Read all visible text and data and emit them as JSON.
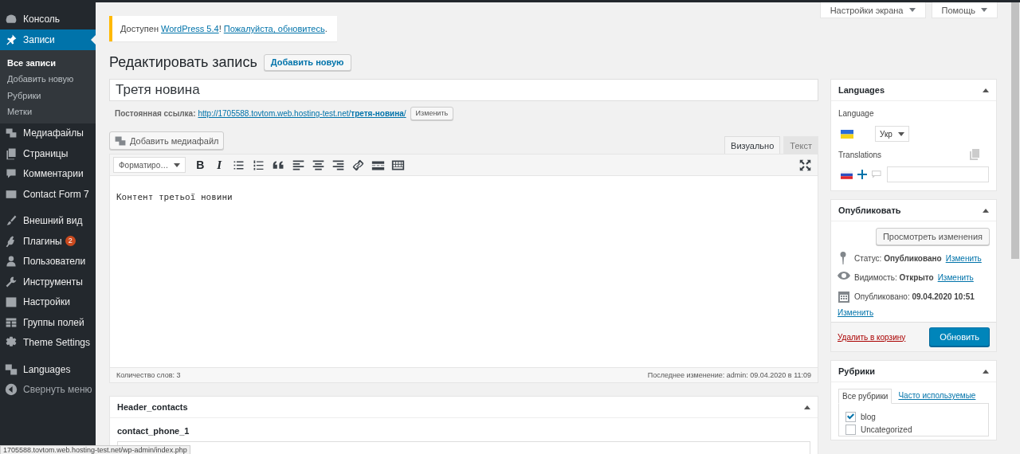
{
  "sidebar": {
    "groups": [
      {
        "items": [
          {
            "label": "Консоль",
            "selected": false
          },
          {
            "label": "Записи",
            "selected": true,
            "children": [
              {
                "label": "Все записи",
                "selected": true
              },
              {
                "label": "Добавить новую",
                "selected": false
              },
              {
                "label": "Рубрики",
                "selected": false
              },
              {
                "label": "Метки",
                "selected": false
              }
            ]
          },
          {
            "label": "Медиафайлы",
            "selected": false
          },
          {
            "label": "Страницы",
            "selected": false
          },
          {
            "label": "Комментарии",
            "selected": false
          },
          {
            "label": "Contact Form 7",
            "selected": false
          }
        ]
      },
      {
        "items": [
          {
            "label": "Внешний вид",
            "selected": false
          },
          {
            "label": "Плагины",
            "selected": false,
            "badge": "2"
          },
          {
            "label": "Пользователи",
            "selected": false
          },
          {
            "label": "Инструменты",
            "selected": false
          },
          {
            "label": "Настройки",
            "selected": false
          },
          {
            "label": "Группы полей",
            "selected": false
          },
          {
            "label": "Theme Settings",
            "selected": false
          }
        ]
      },
      {
        "items": [
          {
            "label": "Languages",
            "selected": false
          }
        ]
      }
    ],
    "collapse": "Свернуть меню"
  },
  "screen_tabs": [
    {
      "label": "Настройки экрана"
    },
    {
      "label": "Помощь"
    }
  ],
  "notice": [
    {
      "kind": "text",
      "text": "Доступен "
    },
    {
      "kind": "link",
      "text": "WordPress 5.4"
    },
    {
      "kind": "text",
      "text": "! "
    },
    {
      "kind": "link",
      "text": "Пожалуйста, обновитесь"
    },
    {
      "kind": "text",
      "text": "."
    }
  ],
  "page_title": "Редактировать запись",
  "add_new_button": "Добавить новую",
  "post_title": "Третя новина",
  "permalink": {
    "label": "Постоянная ссылка:",
    "url": "http://1705588.tovtom.web.hosting-test.net/**третя-новина**/",
    "button": "Изменить"
  },
  "add_media_button": "Добавить медиафайл",
  "editor_tabs": [
    {
      "label": "Визуально",
      "selected": true
    },
    {
      "label": "Текст",
      "selected": false
    }
  ],
  "toolbar": {
    "format": "Форматиро…",
    "buttons": [
      {
        "kind": "bold",
        "label": "B"
      },
      {
        "kind": "italic",
        "label": "I"
      },
      {
        "kind": "bullets"
      },
      {
        "kind": "numbers"
      },
      {
        "kind": "quote"
      },
      {
        "kind": "align-left"
      },
      {
        "kind": "align-center"
      },
      {
        "kind": "align-right"
      },
      {
        "kind": "link"
      },
      {
        "kind": "more"
      },
      {
        "kind": "toggle"
      }
    ]
  },
  "content": "Контент третьої новини",
  "word_count": "Количество слов: 3",
  "last_modified": "Последнее изменение: admin: 09.04.2020 в 11:09",
  "custom_fields": {
    "title": "Header_contacts",
    "fields": [
      {
        "label": "contact_phone_1"
      }
    ]
  },
  "languages": {
    "title": "Languages",
    "language_label": "Language",
    "language_select": "Укр",
    "translations_label": "Translations"
  },
  "publish": {
    "title": "Опубликовать",
    "preview_button": "Просмотреть изменения",
    "rows": [
      {
        "kind": "status",
        "text": "Статус: **Опубликовано**",
        "link": "Изменить"
      },
      {
        "kind": "visibility",
        "text": "Видимость: **Открыто**",
        "link": "Изменить"
      },
      {
        "kind": "date",
        "text": "Опубликовано: **09.04.2020 10:51**",
        "link": "Изменить"
      }
    ],
    "trash": "Удалить в корзину",
    "update_button": "Обновить"
  },
  "categories": {
    "title": "Рубрики",
    "tabs": [
      {
        "label": "Все рубрики",
        "selected": true
      },
      {
        "label": "Часто используемые",
        "selected": false
      }
    ],
    "items": [
      {
        "label": "blog",
        "checked": true
      },
      {
        "label": "Uncategorized",
        "checked": false
      }
    ]
  },
  "status_url": "1705588.tovtom.web.hosting-test.net/wp-admin/index.php"
}
